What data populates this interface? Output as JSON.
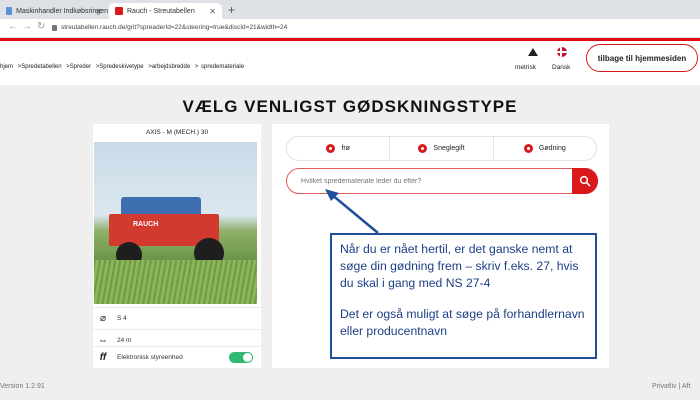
{
  "browser": {
    "tabs": [
      {
        "label": "Maskinhandler Indkøbsringen",
        "active": false
      },
      {
        "label": "Rauch - Streutabellen",
        "active": true
      }
    ],
    "url": "streutabellen.rauch.de/grit?spreaderId=22&steering=true&discId=21&width=24"
  },
  "header": {
    "breadcrumbs": [
      "hjem",
      ">Spredetabellen",
      ">Spreder",
      ">Spredeskivetype",
      ">arbejdsbredde",
      ">",
      "spredemateriale"
    ],
    "unit_label": "metrisk",
    "language_label": "Dansk",
    "home_button": "tilbage til hjemmesiden"
  },
  "page": {
    "title": "VÆLG VENLIGST GØDSKNINGSTYPE"
  },
  "machine_card": {
    "name": "AXIS - M (MECH.) 30",
    "specs": [
      {
        "icon": "disc-icon",
        "value": "S 4"
      },
      {
        "icon": "width-icon",
        "value": "24 m"
      },
      {
        "icon": "control-icon",
        "value": "Elektronisk styreenhed"
      }
    ],
    "electronic_control_enabled": true
  },
  "filter_tabs": [
    "frø",
    "Sneglegift",
    "Gødning"
  ],
  "search": {
    "placeholder": "Hvilket spredemateriale leder du efter?"
  },
  "annotation": {
    "paragraph1": "Når du er nået hertil, er det ganske nemt at søge din gødning frem – skriv f.eks. 27, hvis du skal i gang med NS 27-4",
    "paragraph2": "Det er også muligt at søge på forhandlernavn eller producentnavn"
  },
  "footer": {
    "version": "Version 1.2.91",
    "links": "Privatliv | Aft"
  },
  "colors": {
    "brand_red": "#d9181b",
    "annotation_blue": "#1f4e9a",
    "toggle_green": "#2eb872"
  }
}
